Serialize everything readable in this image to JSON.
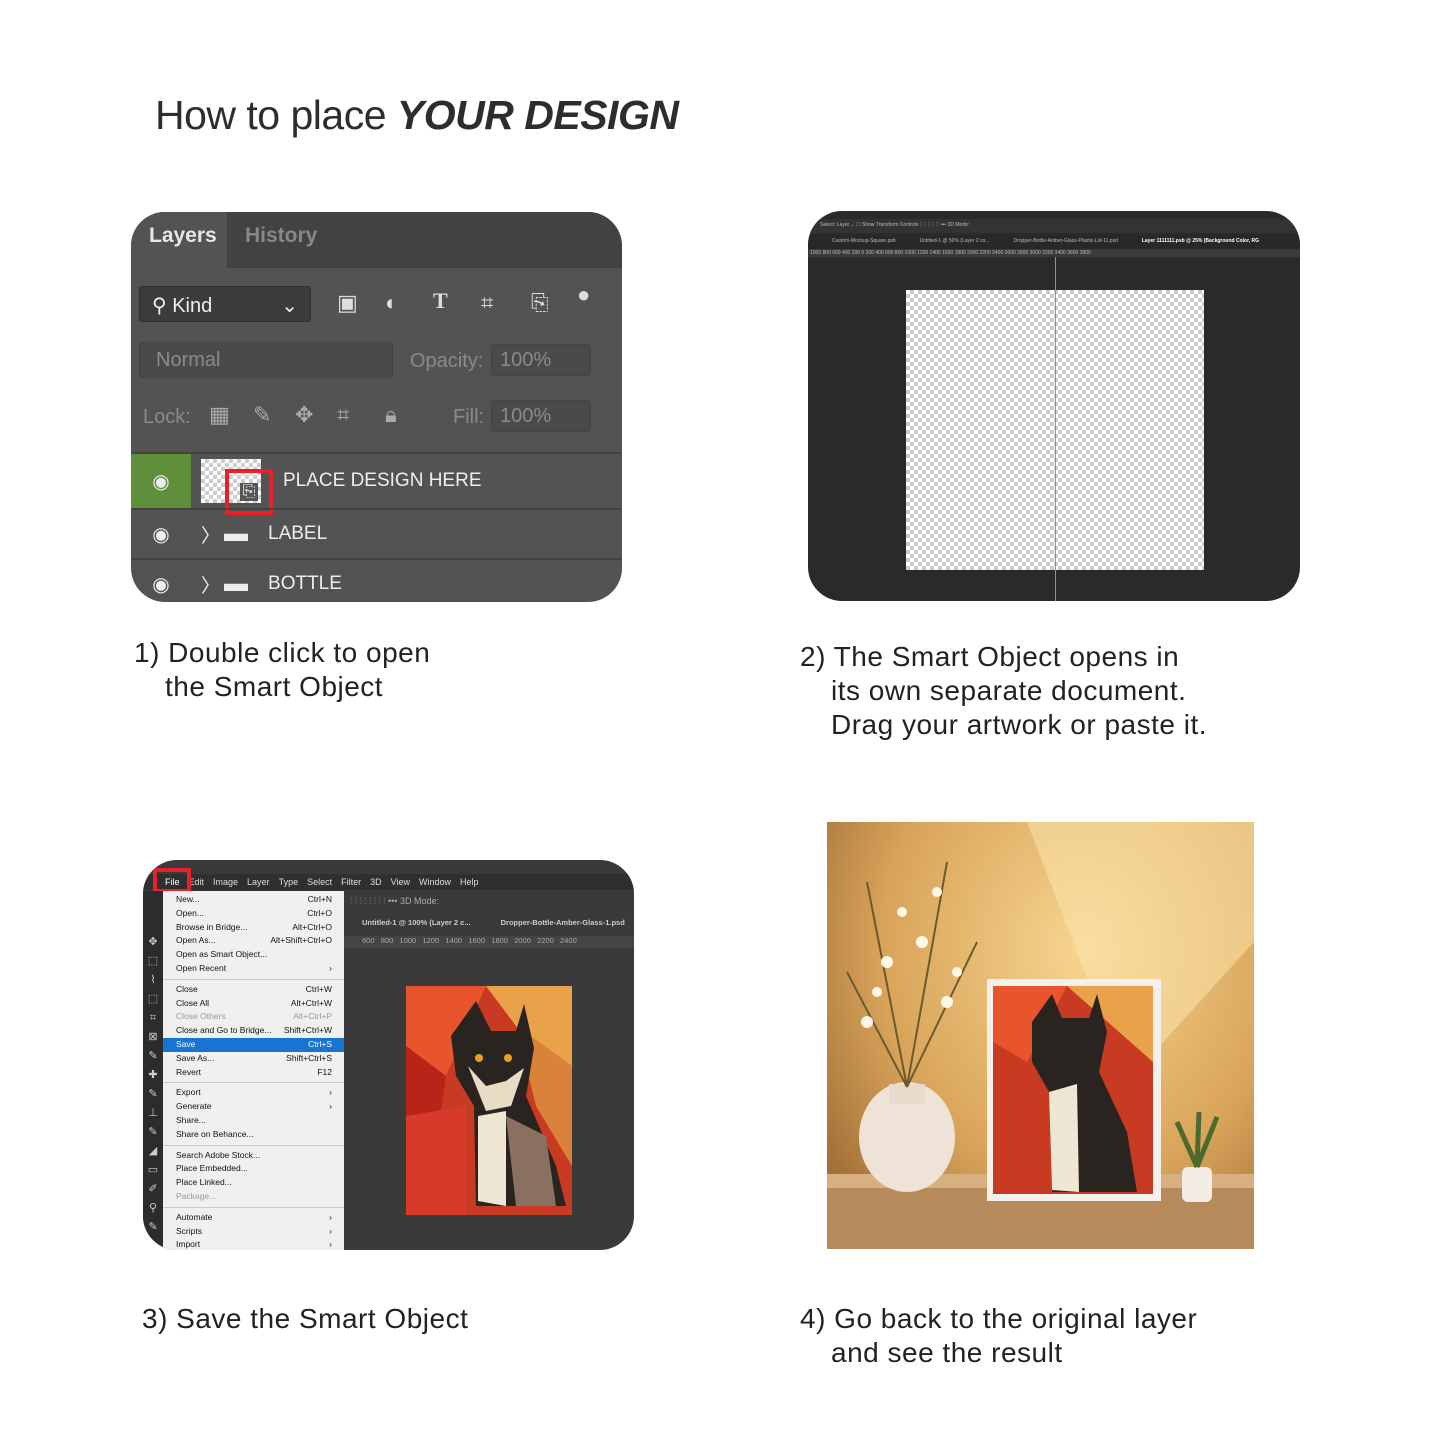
{
  "title": {
    "main": "How to place ",
    "emph": "YOUR DESIGN"
  },
  "step1": {
    "tabs": [
      "Layers",
      "History"
    ],
    "kind_label": "Kind",
    "blend_mode": "Normal",
    "opacity_label": "Opacity:",
    "opacity_value": "100%",
    "lock_label": "Lock:",
    "fill_label": "Fill:",
    "fill_value": "100%",
    "layers": [
      {
        "name": "PLACE DESIGN HERE",
        "type": "smart-object",
        "selected": true
      },
      {
        "name": "LABEL",
        "type": "group"
      },
      {
        "name": "BOTTLE",
        "type": "group"
      }
    ],
    "caption": [
      "1) Double click to open",
      "the Smart Object"
    ]
  },
  "step2": {
    "options": "Select:  Layer ⌄   ☐ Show Transform Controls      ⫶ ⫶ ⫶  ⫶   ⫶ ⫶ ⫶  ⫶   •••   3D Mode:",
    "doc_tabs": [
      "Custom-Mockup-Square.psb",
      "Untitled-1 @ 50% (Layer 2 co...",
      "Dropper-Bottle-Amber-Glass-Plastic-Lid-11.psd",
      "Layer 1111111.psb @ 25% (Background Color, RG"
    ],
    "ruler": "1000  800  600  400  200  0   200  400  600  800  1000  1200  1400  1600  1800  2000  2200  2400  2600  2800  3000  3200  3400  3600  3800",
    "caption": [
      "2) The Smart Object opens in",
      "its own separate document.",
      "Drag your artwork or paste it."
    ]
  },
  "step3": {
    "menubar": [
      "File",
      "Edit",
      "Image",
      "Layer",
      "Type",
      "Select",
      "Filter",
      "3D",
      "View",
      "Window",
      "Help"
    ],
    "doc_tabs": [
      "Untitled-1 @ 100% (Layer 2 c...",
      "Dropper-Bottle-Amber-Glass-1.psd"
    ],
    "ruler": "600   800   1000   1200   1400   1600   1800   2000   2200   2400",
    "menu": [
      {
        "label": "New...",
        "shortcut": "Ctrl+N"
      },
      {
        "label": "Open...",
        "shortcut": "Ctrl+O"
      },
      {
        "label": "Browse in Bridge...",
        "shortcut": "Alt+Ctrl+O"
      },
      {
        "label": "Open As...",
        "shortcut": "Alt+Shift+Ctrl+O"
      },
      {
        "label": "Open as Smart Object...",
        "shortcut": ""
      },
      {
        "label": "Open Recent",
        "shortcut": "›"
      },
      {
        "sep": true
      },
      {
        "label": "Close",
        "shortcut": "Ctrl+W"
      },
      {
        "label": "Close All",
        "shortcut": "Alt+Ctrl+W"
      },
      {
        "label": "Close Others",
        "shortcut": "Alt+Ctrl+P",
        "disabled": true
      },
      {
        "label": "Close and Go to Bridge...",
        "shortcut": "Shift+Ctrl+W"
      },
      {
        "label": "Save",
        "shortcut": "Ctrl+S",
        "selected": true
      },
      {
        "label": "Save As...",
        "shortcut": "Shift+Ctrl+S"
      },
      {
        "label": "Revert",
        "shortcut": "F12"
      },
      {
        "sep": true
      },
      {
        "label": "Export",
        "shortcut": "›"
      },
      {
        "label": "Generate",
        "shortcut": "›"
      },
      {
        "label": "Share...",
        "shortcut": ""
      },
      {
        "label": "Share on Behance...",
        "shortcut": ""
      },
      {
        "sep": true
      },
      {
        "label": "Search Adobe Stock...",
        "shortcut": ""
      },
      {
        "label": "Place Embedded...",
        "shortcut": ""
      },
      {
        "label": "Place Linked...",
        "shortcut": ""
      },
      {
        "label": "Package...",
        "shortcut": "",
        "disabled": true
      },
      {
        "sep": true
      },
      {
        "label": "Automate",
        "shortcut": "›"
      },
      {
        "label": "Scripts",
        "shortcut": "›"
      },
      {
        "label": "Import",
        "shortcut": "›"
      }
    ],
    "caption": [
      "3) Save the Smart Object"
    ]
  },
  "step4": {
    "caption": [
      "4) Go back to the original layer",
      "and see the result"
    ]
  },
  "colors": {
    "highlight": "#e8202a",
    "selected_layer": "#5f8f3a",
    "menu_selected": "#1874d1"
  }
}
